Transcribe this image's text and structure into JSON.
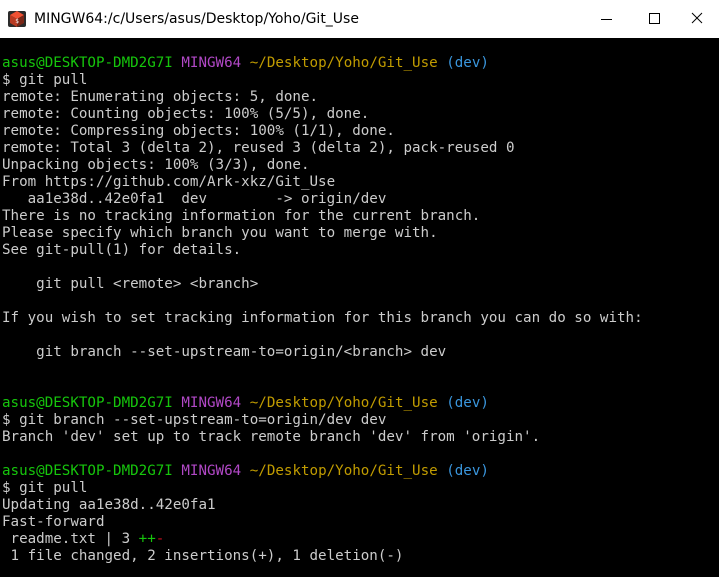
{
  "window": {
    "title": "MINGW64:/c/Users/asus/Desktop/Yoho/Git_Use",
    "app_icon": "git-bash-icon",
    "controls": [
      "minimize-icon",
      "maximize-icon",
      "close-icon"
    ]
  },
  "colors": {
    "user_host": "#16c60c",
    "mingw": "#b148c6",
    "path": "#c19c00",
    "branch": "#3a96dd",
    "text": "#cccccc",
    "insertions": "#16c60c",
    "deletions": "#c50f1f"
  },
  "prompts": [
    {
      "user_host": "asus@DESKTOP-DMD2G7I",
      "env": "MINGW64",
      "path": "~/Desktop/Yoho/Git_Use",
      "branch": "(dev)"
    },
    {
      "user_host": "asus@DESKTOP-DMD2G7I",
      "env": "MINGW64",
      "path": "~/Desktop/Yoho/Git_Use",
      "branch": "(dev)"
    },
    {
      "user_host": "asus@DESKTOP-DMD2G7I",
      "env": "MINGW64",
      "path": "~/Desktop/Yoho/Git_Use",
      "branch": "(dev)"
    }
  ],
  "commands": [
    "$ git pull",
    "$ git branch --set-upstream-to=origin/dev dev",
    "$ git pull"
  ],
  "output1": [
    "remote: Enumerating objects: 5, done.",
    "remote: Counting objects: 100% (5/5), done.",
    "remote: Compressing objects: 100% (1/1), done.",
    "remote: Total 3 (delta 2), reused 3 (delta 2), pack-reused 0",
    "Unpacking objects: 100% (3/3), done.",
    "From https://github.com/Ark-xkz/Git_Use",
    "   aa1e38d..42e0fa1  dev        -> origin/dev",
    "There is no tracking information for the current branch.",
    "Please specify which branch you want to merge with.",
    "See git-pull(1) for details.",
    "",
    "    git pull <remote> <branch>",
    "",
    "If you wish to set tracking information for this branch you can do so with:",
    "",
    "    git branch --set-upstream-to=origin/<branch> dev"
  ],
  "output2": [
    "Branch 'dev' set up to track remote branch 'dev' from 'origin'."
  ],
  "output3": [
    "Updating aa1e38d..42e0fa1",
    "Fast-forward"
  ],
  "diffstat": {
    "file": " readme.txt | 3 ",
    "plus": "++",
    "minus": "-"
  },
  "summary": " 1 file changed, 2 insertions(+), 1 deletion(-)"
}
